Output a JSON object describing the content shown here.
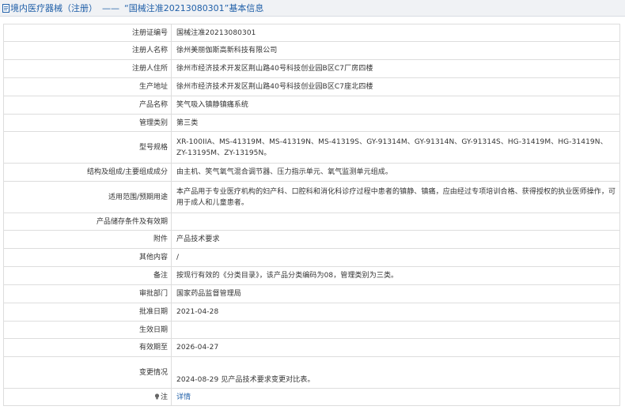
{
  "header": {
    "category": "境内医疗器械（注册）",
    "separator": "——",
    "title": "“国械注准20213080301”基本信息"
  },
  "rows": [
    {
      "label": "注册证编号",
      "value": "国械注准20213080301"
    },
    {
      "label": "注册人名称",
      "value": "徐州美丽伽斯高新科技有限公司"
    },
    {
      "label": "注册人住所",
      "value": "徐州市经济技术开发区荆山路40号科技创业园B区C7厂房四楼"
    },
    {
      "label": "生产地址",
      "value": "徐州市经济技术开发区荆山路40号科技创业园B区C7座北四楼"
    },
    {
      "label": "产品名称",
      "value": "笑气吸入镇静镇痛系统"
    },
    {
      "label": "管理类别",
      "value": "第三类"
    },
    {
      "label": "型号规格",
      "value": "XR-100IIA、MS-41319M、MS-41319N、MS-41319S、GY-91314M、GY-91314N、GY-91314S、HG-31419M、HG-31419N、ZY-13195M、ZY-13195N。"
    },
    {
      "label": "结构及组成/主要组成成分",
      "value": "由主机、笑气氧气混合调节器、压力指示单元、氧气监测单元组成。"
    },
    {
      "label": "适用范围/预期用途",
      "value": "本产品用于专业医疗机构的妇产科、口腔科和消化科诊疗过程中患者的镇静、镇痛，应由经过专项培训合格、获得授权的执业医师操作，可用于成人和儿童患者。"
    },
    {
      "label": "产品储存条件及有效期",
      "value": ""
    },
    {
      "label": "附件",
      "value": "产品技术要求"
    },
    {
      "label": "其他内容",
      "value": "/"
    },
    {
      "label": "备注",
      "value": "按现行有效的《分类目录》，该产品分类编码为08，管理类别为三类。"
    },
    {
      "label": "审批部门",
      "value": "国家药品监督管理局"
    },
    {
      "label": "批准日期",
      "value": "2021-04-28"
    },
    {
      "label": "生效日期",
      "value": ""
    },
    {
      "label": "有效期至",
      "value": "2026-04-27"
    },
    {
      "label": "变更情况",
      "value": "2024-08-29 见产品技术要求变更对比表。"
    },
    {
      "label": "注",
      "value": "详情",
      "icon": "bulb-icon"
    }
  ]
}
